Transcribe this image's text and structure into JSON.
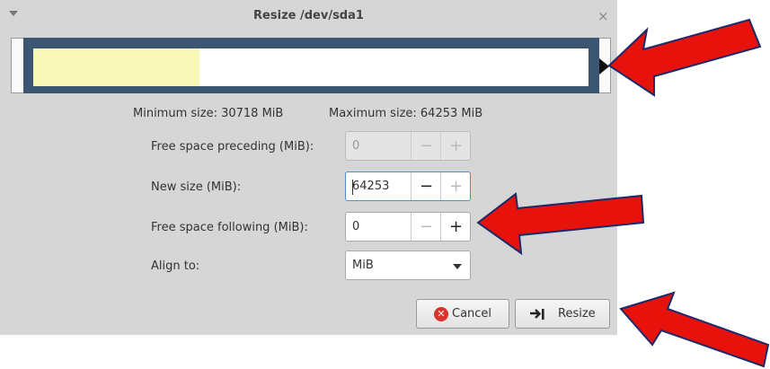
{
  "dialog": {
    "title": "Resize /dev/sda1",
    "menu_icon": "chevron-down-icon",
    "close_glyph": "×"
  },
  "partition_bar": {
    "used_fraction": 0.3,
    "used_color": "#f8f6b8",
    "frame_color": "#3b5670"
  },
  "limits": {
    "minimum": "Minimum size: 30718 MiB",
    "maximum": "Maximum size: 64253 MiB"
  },
  "fields": {
    "free_preceding": {
      "label": "Free space preceding (MiB):",
      "value": "0"
    },
    "new_size": {
      "label": "New size (MiB):",
      "value": "64253"
    },
    "free_following": {
      "label": "Free space following (MiB):",
      "value": "0"
    },
    "align": {
      "label": "Align to:",
      "value": "MiB"
    }
  },
  "spin_glyphs": {
    "minus": "−",
    "plus": "+"
  },
  "buttons": {
    "cancel": "Cancel",
    "resize": "Resize"
  },
  "annotation_color": "#e8120c"
}
